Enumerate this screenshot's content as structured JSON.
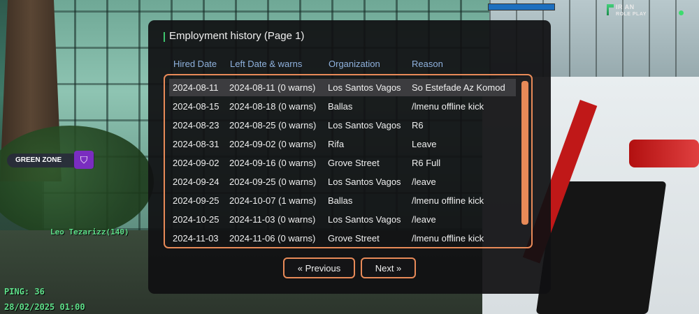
{
  "hud": {
    "logo_line1": "IR AN",
    "logo_line2": "ROLE PLAY",
    "zone_label": "GREEN ZONE",
    "zone_icon": "shield-icon",
    "player_name": "Leo Tezarizz(140)",
    "ping": "PING: 36",
    "datetime": "28/02/2025 01:00",
    "top_bar_level": 1.0,
    "colors": {
      "hud_text": "#5fe08a",
      "zone_badge": "#7a2dc0",
      "status_dot": "#3ddc6e"
    }
  },
  "dialog": {
    "title": "Employment history (Page 1)",
    "headers": [
      "Hired Date",
      "Left Date & warns",
      "Organization",
      "Reason"
    ],
    "rows": [
      [
        "2024-08-11",
        "2024-08-11 (0 warns)",
        "Los Santos Vagos",
        "So Estefade Az Komod"
      ],
      [
        "2024-08-15",
        "2024-08-18 (0 warns)",
        "Ballas",
        "/lmenu offline kick"
      ],
      [
        "2024-08-23",
        "2024-08-25 (0 warns)",
        "Los Santos Vagos",
        "R6"
      ],
      [
        "2024-08-31",
        "2024-09-02 (0 warns)",
        "Rifa",
        "Leave"
      ],
      [
        "2024-09-02",
        "2024-09-16 (0 warns)",
        "Grove Street",
        "R6 Full"
      ],
      [
        "2024-09-24",
        "2024-09-25 (0 warns)",
        "Los Santos Vagos",
        "/leave"
      ],
      [
        "2024-09-25",
        "2024-10-07 (1 warns)",
        "Ballas",
        "/lmenu offline kick"
      ],
      [
        "2024-10-25",
        "2024-11-03 (0 warns)",
        "Los Santos Vagos",
        "/leave"
      ],
      [
        "2024-11-03",
        "2024-11-06 (0 warns)",
        "Grove Street",
        "/lmenu offline kick"
      ]
    ],
    "selected_row": 0,
    "buttons": {
      "previous": "« Previous",
      "next": "Next »"
    },
    "colors": {
      "accent": "#e88a58",
      "header_text": "#8fb2de",
      "title_marker": "#3ec46d",
      "selected_row": "#3c3c3f"
    }
  }
}
